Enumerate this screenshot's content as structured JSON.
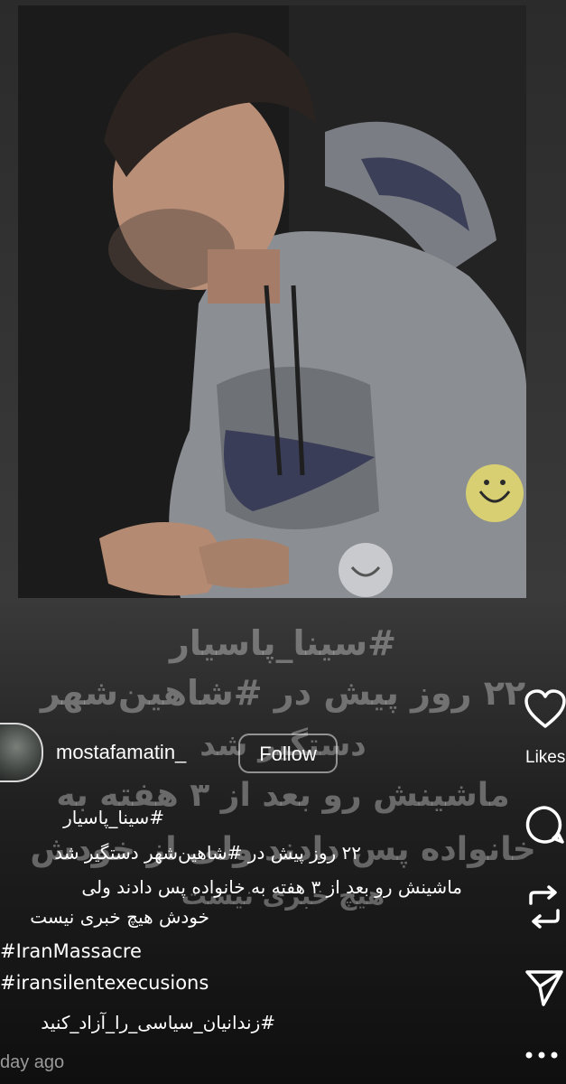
{
  "post": {
    "overlay_lines": [
      "#سینا_پاسیار",
      "۲۲ روز پیش در #شاهین‌شهر",
      "دستگیر شد",
      "ماشینش رو بعد از ۳ هفته به",
      "خانواده پس دادند ولی از خودش",
      "هیچ خبری نیست"
    ],
    "author": {
      "username": "mostafamatin_",
      "follow_label": "Follow"
    },
    "caption": [
      "#سینا_پاسیار",
      "۲۲ روز پیش در #شاهین‌شهر دستگیر شد",
      "ماشینش رو بعد از ۳ هفته به خانواده پس دادند  ولی",
      "خودش هیچ خبری نیست",
      "#IranMassacre",
      "#iransilentexecusions",
      "#زندانیان_سیاسی_را_آزاد_کنید"
    ],
    "time_ago": "day ago"
  },
  "actions": {
    "likes_label": "Likes",
    "icons": [
      "heart-icon",
      "comment-icon",
      "repost-icon",
      "share-icon",
      "more-icon"
    ]
  },
  "colors": {
    "background": "#2f2f2f",
    "text": "#ffffff",
    "muted": "#9a9a9a"
  }
}
